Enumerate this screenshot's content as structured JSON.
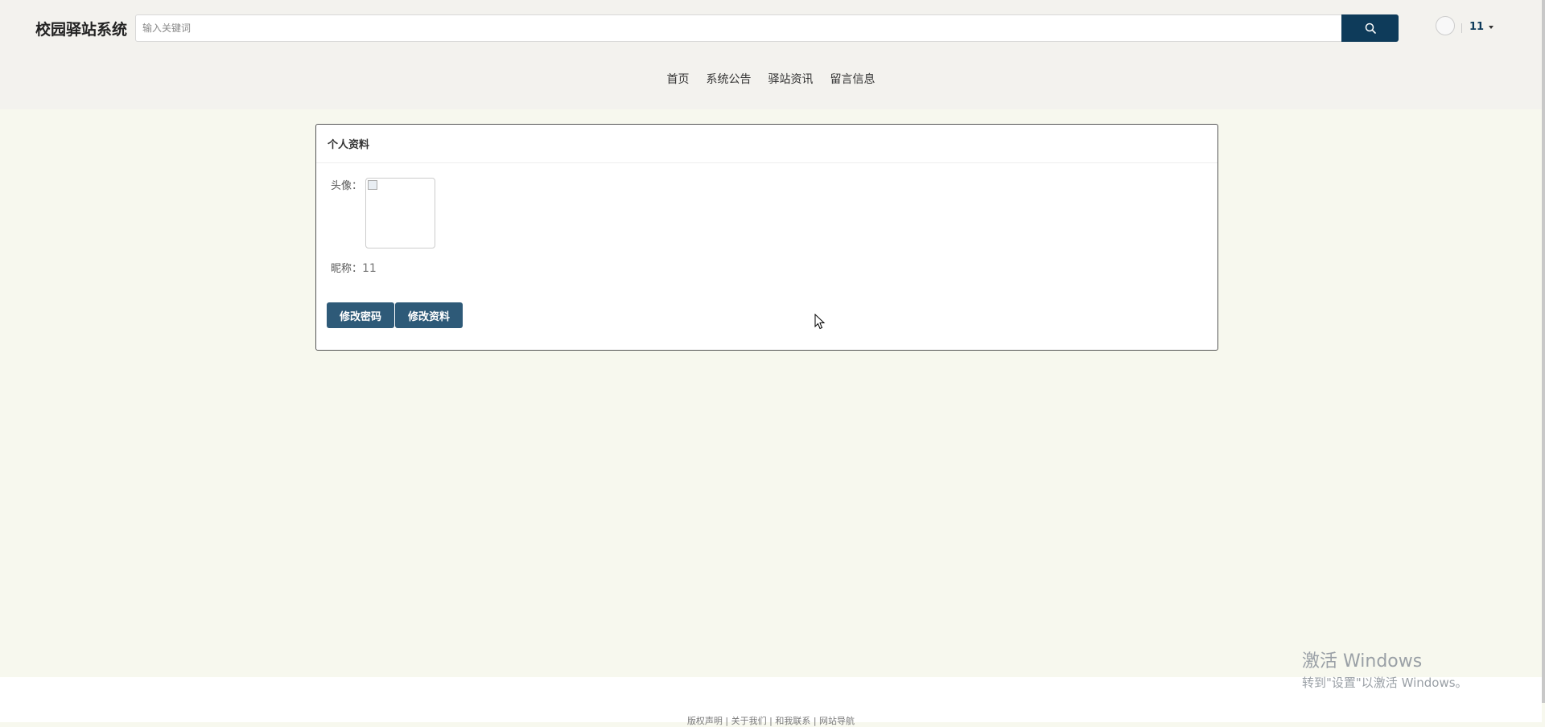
{
  "header": {
    "logo": "校园驿站系统",
    "search": {
      "placeholder": "输入关键词"
    },
    "user": {
      "name": "11"
    }
  },
  "nav": [
    "首页",
    "系统公告",
    "驿站资讯",
    "留言信息"
  ],
  "profile": {
    "title": "个人资料",
    "avatar_label": "头像：",
    "nickname_label": "昵称：",
    "nickname_value": "11",
    "buttons": [
      "修改密码",
      "修改资料"
    ]
  },
  "footer": {
    "links": "版权声明 | 关于我们 | 和我联系 | 网站导航"
  },
  "watermark": {
    "line1": "激活 Windows",
    "line2": "转到\"设置\"以激活 Windows。"
  },
  "colors": {
    "accent": "#0e3b5a",
    "button": "#2e5a78",
    "header_bg": "#f3f2ee",
    "page_bg": "#f7f8ee"
  },
  "icons": [
    "search-icon",
    "caret-down-icon",
    "broken-image-icon",
    "cursor-icon"
  ]
}
